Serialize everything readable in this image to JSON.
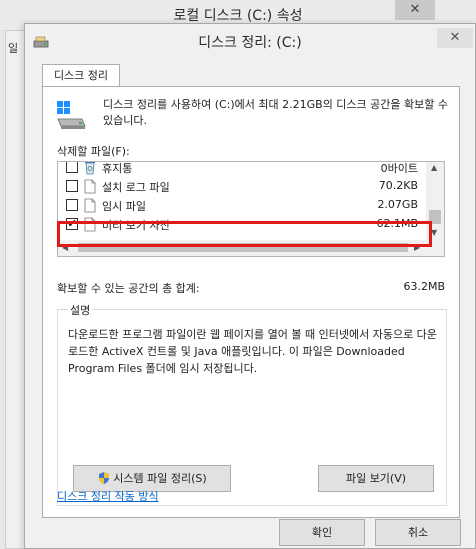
{
  "background_window": {
    "title": "로컬 디스크 (C:) 속성",
    "close_symbol": "✕",
    "left_edge_text": "일"
  },
  "dialog": {
    "title": "디스크 정리: (C:)",
    "close_symbol": "✕",
    "tab_label": "디스크 정리",
    "intro_text": "디스크 정리를 사용하여 (C:)에서 최대 2.21GB의 디스크 공간을 확보할 수 있습니다.",
    "files_label": "삭제할 파일(F):",
    "files": [
      {
        "name": "휴지통",
        "size": "0바이트",
        "checked": false,
        "icon": "recycle-bin-icon"
      },
      {
        "name": "설치 로그 파일",
        "size": "70.2KB",
        "checked": false,
        "icon": "file-icon"
      },
      {
        "name": "임시 파일",
        "size": "2.07GB",
        "checked": false,
        "icon": "file-icon",
        "highlighted": true
      },
      {
        "name": "미리 보기 사진",
        "size": "62.1MB",
        "checked": true,
        "icon": "file-icon"
      }
    ],
    "total_label": "확보할 수 있는 공간의 총 합계:",
    "total_value": "63.2MB",
    "description_title": "설명",
    "description_text": "다운로드한 프로그램 파일이란 웹 페이지를 열어 볼 때 인터넷에서 자동으로 다운로드한 ActiveX 컨트롤 및 Java 애플릿입니다. 이 파일은 Downloaded Program Files 폴더에 임시 저장됩니다.",
    "cleanup_system_button": "시스템 파일 정리(S)",
    "view_files_button": "파일 보기(V)",
    "how_link": "디스크 정리 작동 방식",
    "ok_button": "확인",
    "cancel_button": "취소",
    "check_mark": "✔",
    "highlight_color": "#e01919"
  }
}
